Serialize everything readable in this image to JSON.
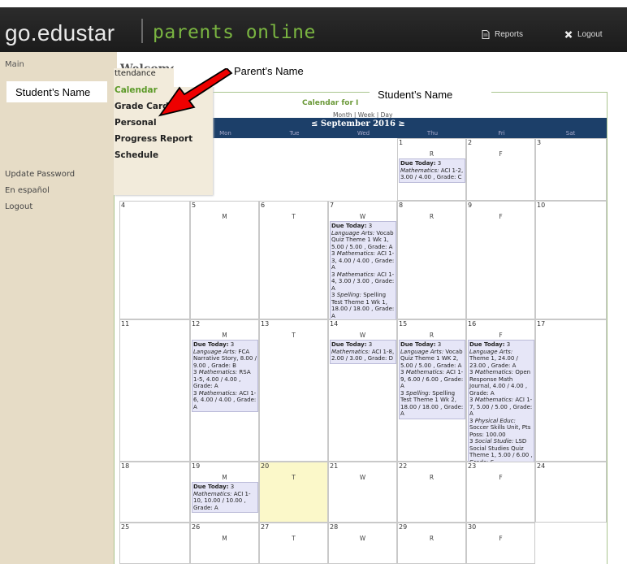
{
  "header": {
    "brand_go": "go.edustar",
    "brand_parents": "parents online",
    "reports": "Reports",
    "logout": "Logout"
  },
  "sidebar": {
    "main": "Main",
    "links": [
      "Update Password",
      "En español",
      "Logout"
    ]
  },
  "welcome": "Welcome",
  "overlays": {
    "parent_name": "Parent’s Name",
    "student_name_left": "Student’s Name",
    "student_name_right": "Student’s Name"
  },
  "menu": [
    "ttendance",
    "Calendar",
    "Grade Card",
    "Personal",
    "Progress Report",
    "Schedule"
  ],
  "calendar": {
    "title": "Calendar for I",
    "views": "Month | Week | Day",
    "month": "≤ September 2016 ≥",
    "dow": [
      "Mon",
      "Tue",
      "Wed",
      "Thu",
      "Fri",
      "Sat"
    ],
    "days": [
      {
        "n": "1",
        "l": "R"
      },
      {
        "n": "2",
        "l": "F"
      },
      {
        "n": "3",
        "l": ""
      },
      {
        "n": "4",
        "l": ""
      },
      {
        "n": "5",
        "l": "M"
      },
      {
        "n": "6",
        "l": "T"
      },
      {
        "n": "7",
        "l": "W"
      },
      {
        "n": "8",
        "l": "R"
      },
      {
        "n": "9",
        "l": "F"
      },
      {
        "n": "10",
        "l": ""
      },
      {
        "n": "11",
        "l": ""
      },
      {
        "n": "12",
        "l": "M"
      },
      {
        "n": "13",
        "l": "T"
      },
      {
        "n": "14",
        "l": "W"
      },
      {
        "n": "15",
        "l": "R"
      },
      {
        "n": "16",
        "l": "F"
      },
      {
        "n": "17",
        "l": ""
      },
      {
        "n": "18",
        "l": ""
      },
      {
        "n": "19",
        "l": "M"
      },
      {
        "n": "20",
        "l": "T"
      },
      {
        "n": "21",
        "l": "W"
      },
      {
        "n": "22",
        "l": "R"
      },
      {
        "n": "23",
        "l": "F"
      },
      {
        "n": "24",
        "l": ""
      },
      {
        "n": "25",
        "l": ""
      },
      {
        "n": "26",
        "l": "M"
      },
      {
        "n": "27",
        "l": "T"
      },
      {
        "n": "28",
        "l": "W"
      },
      {
        "n": "29",
        "l": "R"
      },
      {
        "n": "30",
        "l": "F"
      }
    ],
    "due": {
      "d1": "<b>Due Today:</b> 3<br><i>Mathematics:</i> ACI 1-2, 3.00 / 4.00 , Grade: C",
      "d7": "<b>Due Today:</b> 3<br><i>Language Arts:</i> Vocab Quiz Theme 1 Wk 1, 5.00 / 5.00 , Grade: A<br>3 <i>Mathematics:</i> ACI 1-3, 4.00 / 4.00 , Grade: A<br>3 <i>Mathematics:</i> ACI 1-4, 3.00 / 3.00 , Grade: A<br>3 <i>Spelling:</i> Spelling Test Theme 1 Wk 1, 18.00 / 18.00 , Grade: A",
      "d12": "<b>Due Today:</b> 3<br><i>Language Arts:</i> FCA Narrative Story, 8.00 / 9.00 , Grade: B<br>3 <i>Mathematics:</i> RSA 1-5, 4.00 / 4.00 , Grade: A<br>3 <i>Mathematics:</i> ACI 1-6, 4.00 / 4.00 , Grade: A",
      "d14": "<b>Due Today:</b> 3<br><i>Mathematics:</i> ACI 1-8, 2.00 / 3.00 , Grade: D",
      "d15": "<b>Due Today:</b> 3<br><i>Language Arts:</i> Vocab Quiz Theme 1 WK 2, 5.00 / 5.00 , Grade: A<br>3 <i>Mathematics:</i> ACI 1-9, 6.00 / 6.00 , Grade: A<br>3 <i>Spelling:</i> Spelling Test Theme 1 Wk 2, 18.00 / 18.00 , Grade: A",
      "d16": "<b>Due Today:</b> 3<br><i>Language Arts:</i> Theme 1, 24.00 / 23.00 , Grade: A<br>3 <i>Mathematics:</i> Open Response Math Journal, 4.00 / 4.00 , Grade: A<br>3 <i>Mathematics:</i> ACI 1-7, 5.00 / 5.00 , Grade: A<br>3 <i>Physical Educ:</i> Soccer Skills Unit, Pts Poss: 100.00<br>3 <i>Social Studie:</i> LSD Social Studies Quiz Theme 1, 5.00 / 6.00 , Grade: S",
      "d19": "<b>Due Today:</b> 3<br><i>Mathematics:</i> ACI 1-10, 10.00 / 10.00 , Grade: A"
    }
  }
}
